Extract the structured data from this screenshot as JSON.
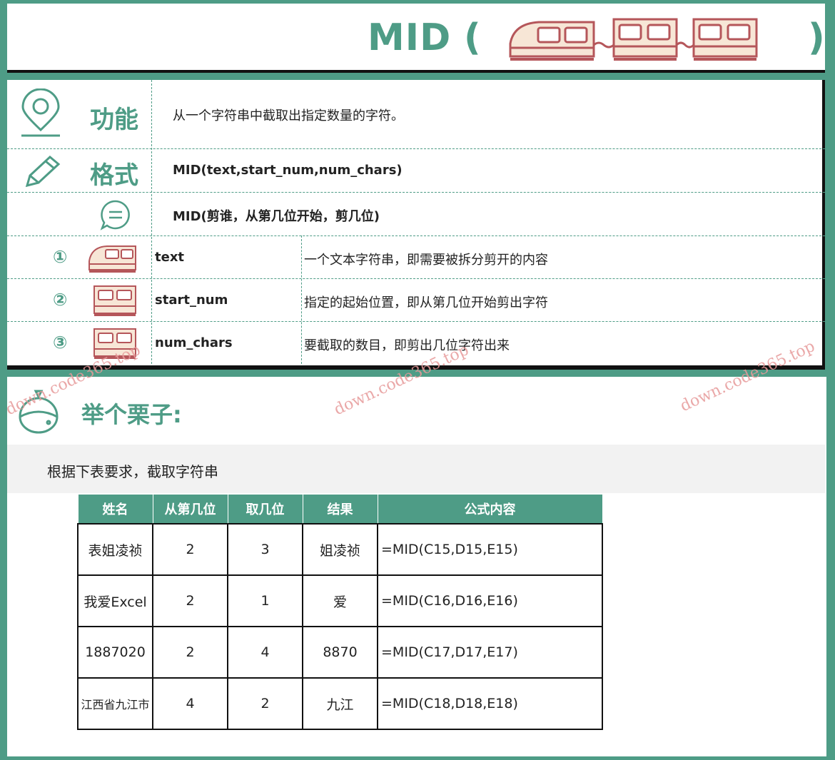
{
  "title": {
    "text": "MID",
    "open_paren": "(",
    "close_paren": ")",
    "icon": "train-icon"
  },
  "info": {
    "function": {
      "icon": "location-pin-icon",
      "label": "功能",
      "text": "从一个字符串中截取出指定数量的字符。"
    },
    "format": {
      "icon": "pencil-icon",
      "label": "格式",
      "syntax": "MID(text,start_num,num_chars)"
    },
    "meaning": {
      "icon": "chat-bubble-icon",
      "text": "MID(剪谁，从第几位开始，剪几位)"
    },
    "params": [
      {
        "num": "①",
        "icon": "train-head-icon",
        "name": "text",
        "desc": "一个文本字符串，即需要被拆分剪开的内容"
      },
      {
        "num": "②",
        "icon": "train-car-icon",
        "name": "start_num",
        "desc": "指定的起始位置，即从第几位开始剪出字符"
      },
      {
        "num": "③",
        "icon": "train-car-icon",
        "name": "num_chars",
        "desc": "要截取的数目，即剪出几位字符出来"
      }
    ]
  },
  "example": {
    "icon": "chestnut-icon",
    "title": "举个栗子:",
    "requirement": "根据下表要求，截取字符串",
    "table": {
      "headers": [
        "姓名",
        "从第几位",
        "取几位",
        "结果",
        "公式内容"
      ],
      "rows": [
        [
          "表姐凌祯",
          "2",
          "3",
          "姐凌祯",
          "=MID(C15,D15,E15)"
        ],
        [
          "我爱Excel",
          "2",
          "1",
          "爱",
          "=MID(C16,D16,E16)"
        ],
        [
          "1887020",
          "2",
          "4",
          "8870",
          "=MID(C17,D17,E17)"
        ],
        [
          "江西省九江市",
          "4",
          "2",
          "九江",
          "=MID(C18,D18,E18)"
        ]
      ]
    }
  },
  "watermarks": [
    "down.code365.top",
    "down.code365.top",
    "down.code365.top"
  ],
  "colors": {
    "accent": "#4e9c86",
    "icon_red": "#b5565a",
    "icon_fill": "#f7e6d6"
  }
}
